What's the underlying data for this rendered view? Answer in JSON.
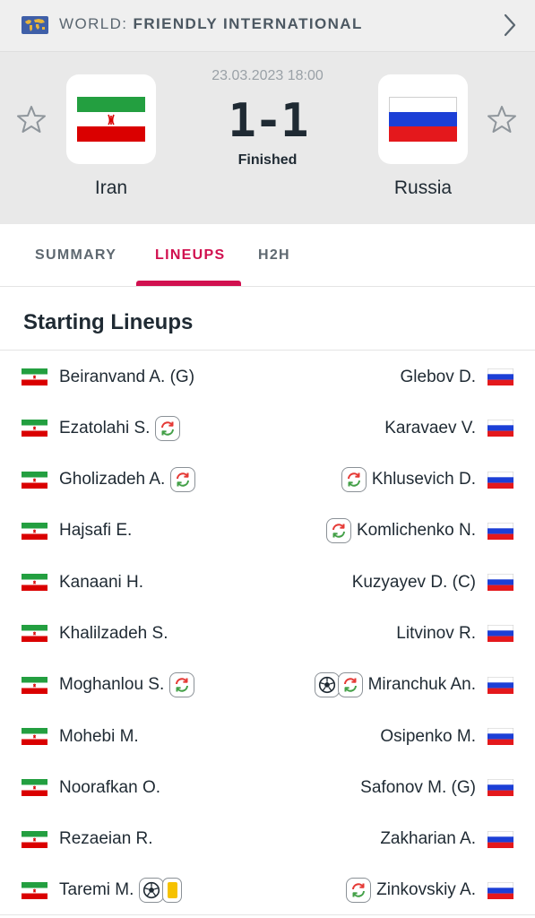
{
  "header": {
    "competition_prefix": "WORLD:",
    "competition_name": "FRIENDLY INTERNATIONAL",
    "icon": "world-map-icon"
  },
  "match": {
    "datetime": "23.03.2023 18:00",
    "score": "1-1",
    "status": "Finished",
    "home": {
      "name": "Iran",
      "flag": "iran-flag"
    },
    "away": {
      "name": "Russia",
      "flag": "russia-flag"
    }
  },
  "tabs": [
    {
      "label": "SUMMARY",
      "active": false
    },
    {
      "label": "LINEUPS",
      "active": true
    },
    {
      "label": "H2H",
      "active": false
    }
  ],
  "section": {
    "title": "Starting Lineups"
  },
  "colors": {
    "accent": "#d1104f",
    "yellow_card": "#f6c200",
    "sub_red": "#e53935",
    "sub_green": "#43a047"
  },
  "lineups": {
    "home": [
      {
        "name": "Beiranvand A. (G)",
        "icons": []
      },
      {
        "name": "Ezatolahi S.",
        "icons": [
          "substitution-icon"
        ]
      },
      {
        "name": "Gholizadeh A.",
        "icons": [
          "substitution-icon"
        ]
      },
      {
        "name": "Hajsafi E.",
        "icons": []
      },
      {
        "name": "Kanaani H.",
        "icons": []
      },
      {
        "name": "Khalilzadeh S.",
        "icons": []
      },
      {
        "name": "Moghanlou S.",
        "icons": [
          "substitution-icon"
        ]
      },
      {
        "name": "Mohebi M.",
        "icons": []
      },
      {
        "name": "Noorafkan O.",
        "icons": []
      },
      {
        "name": "Rezaeian R.",
        "icons": []
      },
      {
        "name": "Taremi M.",
        "icons": [
          "goal-icon",
          "yellow-card-icon"
        ]
      }
    ],
    "away": [
      {
        "name": "Glebov D.",
        "icons": []
      },
      {
        "name": "Karavaev V.",
        "icons": []
      },
      {
        "name": "Khlusevich D.",
        "icons": [
          "substitution-icon"
        ]
      },
      {
        "name": "Komlichenko N.",
        "icons": [
          "substitution-icon"
        ]
      },
      {
        "name": "Kuzyayev D. (C)",
        "icons": []
      },
      {
        "name": "Litvinov R.",
        "icons": []
      },
      {
        "name": "Miranchuk An.",
        "icons": [
          "goal-icon",
          "substitution-icon"
        ]
      },
      {
        "name": "Osipenko M.",
        "icons": []
      },
      {
        "name": "Safonov M. (G)",
        "icons": []
      },
      {
        "name": "Zakharian A.",
        "icons": []
      },
      {
        "name": "Zinkovskiy A.",
        "icons": [
          "substitution-icon"
        ]
      }
    ]
  }
}
